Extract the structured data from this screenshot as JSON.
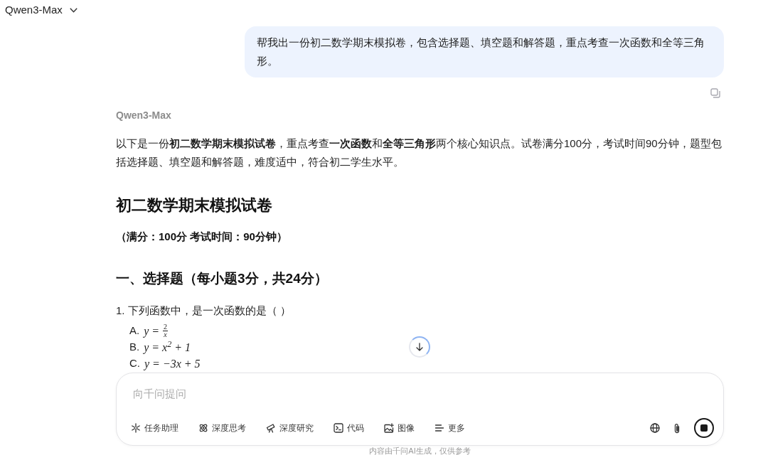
{
  "header": {
    "model": "Qwen3-Max"
  },
  "user_message": {
    "text": "帮我出一份初二数学期末模拟卷，包含选择题、填空题和解答题，重点考查一次函数和全等三角形。"
  },
  "assistant": {
    "name": "Qwen3-Max",
    "intro": "以下是一份**初二数学期末模拟试卷**，重点考查**一次函数**和**全等三角形**两个核心知识点。试卷满分100分，考试时间90分钟，题型包括选择题、填空题和解答题，难度适中，符合初二学生水平。",
    "title": "初二数学期末模拟试卷",
    "info": "（满分：100分 考试时间：90分钟）",
    "section": "一、选择题（每小题3分，共24分）",
    "question": {
      "text": "1. 下列函数中，是一次函数的是（ ）",
      "options": [
        {
          "label": "A.",
          "kind": "fraction",
          "lhs": "y =",
          "numerator": "2",
          "denominator": "x"
        },
        {
          "label": "B.",
          "kind": "expression",
          "expression": "y = x$^{2}$ + 1"
        },
        {
          "label": "C.",
          "kind": "expression",
          "expression": "y = −3x + 5"
        }
      ]
    }
  },
  "composer": {
    "placeholder": "向千问提问",
    "tools": [
      {
        "kind": "task",
        "label": "任务助理"
      },
      {
        "kind": "think",
        "label": "深度思考"
      },
      {
        "kind": "research",
        "label": "深度研究"
      },
      {
        "kind": "code",
        "label": "代码"
      },
      {
        "kind": "image",
        "label": "图像"
      },
      {
        "kind": "more",
        "label": "更多"
      }
    ],
    "generating": true
  },
  "disclaimer": "内容由千问AI生成，仅供参考"
}
